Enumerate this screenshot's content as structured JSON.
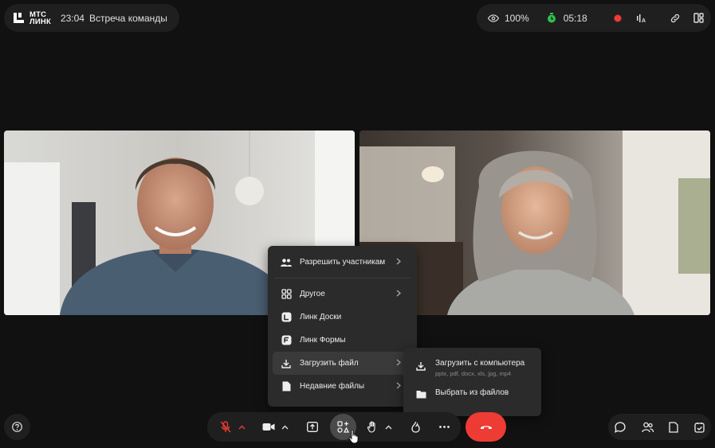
{
  "header": {
    "logo_line1": "МТС",
    "logo_line2": "ЛИНК",
    "time": "23:04",
    "meeting_title": "Встреча команды"
  },
  "status_bar": {
    "visibility": "100%",
    "timer": "05:18",
    "icons": [
      "eye-icon",
      "timer-icon",
      "record-indicator",
      "captions-icon",
      "link-icon",
      "layout-icon"
    ]
  },
  "attach_menu": {
    "items": [
      {
        "label": "Разрешить участникам",
        "icon": "people-icon",
        "has_submenu": true
      },
      {
        "label": "Другое",
        "icon": "apps-icon",
        "has_submenu": true
      },
      {
        "label": "Линк Доски",
        "icon": "board-icon",
        "has_submenu": false
      },
      {
        "label": "Линк Формы",
        "icon": "forms-icon",
        "has_submenu": false
      },
      {
        "label": "Загрузить файл",
        "icon": "download-icon",
        "has_submenu": true,
        "active": true
      },
      {
        "label": "Недавние файлы",
        "icon": "document-icon",
        "has_submenu": true
      }
    ]
  },
  "upload_submenu": {
    "items": [
      {
        "label": "Загрузить с компьютера",
        "hint": "pptx, pdf, docx, xls, jpg, mp4",
        "icon": "download-icon"
      },
      {
        "label": "Выбрать из файлов",
        "hint": "",
        "icon": "folder-icon"
      }
    ]
  },
  "controls": [
    "mic-muted-icon",
    "camera-icon",
    "share-screen-icon",
    "attach-apps-icon",
    "raise-hand-icon",
    "reaction-icon",
    "more-icon"
  ],
  "bottom_right": [
    "chat-icon",
    "participants-icon",
    "notes-icon",
    "tasks-icon"
  ],
  "colors": {
    "background": "#111111",
    "panel": "#1f1f1f",
    "menu": "#2b2b2b",
    "danger": "#ee3b34",
    "timer_green": "#2fbf4f",
    "muted_red": "#ee3b34"
  }
}
